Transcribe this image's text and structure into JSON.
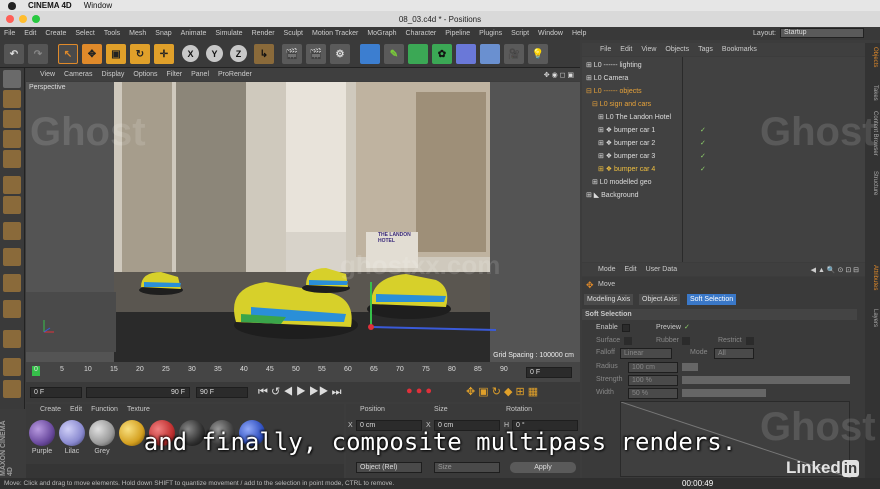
{
  "mac_menu": {
    "app": "CINEMA 4D",
    "window": "Window"
  },
  "window_title": "08_03.c4d * - Positions",
  "menubar": [
    "File",
    "Edit",
    "Create",
    "Select",
    "Tools",
    "Mesh",
    "Snap",
    "Animate",
    "Simulate",
    "Render",
    "Sculpt",
    "Motion Tracker",
    "MoGraph",
    "Character",
    "Pipeline",
    "Plugins",
    "Script",
    "Window",
    "Help"
  ],
  "layout": {
    "label": "Layout:",
    "value": "Startup"
  },
  "viewport_menu": [
    "View",
    "Cameras",
    "Display",
    "Options",
    "Filter",
    "Panel",
    "ProRender"
  ],
  "viewport": {
    "name": "Perspective",
    "grid_spacing": "Grid Spacing : 100000 cm",
    "sign_text": "THE LANDON HOTEL"
  },
  "timeline": {
    "ticks": [
      "0",
      "5",
      "10",
      "15",
      "20",
      "25",
      "30",
      "35",
      "40",
      "45",
      "50",
      "55",
      "60",
      "65",
      "70",
      "75",
      "80",
      "85",
      "90"
    ],
    "current": "0 F"
  },
  "transport": {
    "start": "0 F",
    "end_a": "90 F",
    "end_b": "90 F"
  },
  "materials": {
    "menu": [
      "Create",
      "Edit",
      "Function",
      "Texture"
    ],
    "items": [
      {
        "name": "Purple",
        "color": "#6a4a9e"
      },
      {
        "name": "Lilac",
        "color": "#8a8ad0"
      },
      {
        "name": "Grey",
        "color": "#9a9a9a"
      },
      {
        "name": "",
        "color": "#d4a020"
      },
      {
        "name": "",
        "color": "#c03030"
      },
      {
        "name": "",
        "color": "#303030"
      },
      {
        "name": "",
        "color": "#404040"
      },
      {
        "name": "",
        "color": "#3050c0"
      }
    ]
  },
  "coordinates": {
    "headers": [
      "Position",
      "Size",
      "Rotation"
    ],
    "x_pos": "0 cm",
    "x_size": "0 cm",
    "h_rot": "0 °",
    "axis_x": "X",
    "axis_size": "X",
    "axis_h": "H",
    "mode": "Object (Rel)",
    "size_mode": "Size",
    "apply": "Apply"
  },
  "object_manager": {
    "menu": [
      "File",
      "Edit",
      "View",
      "Objects",
      "Tags",
      "Bookmarks"
    ],
    "rows": [
      {
        "label": "------ lighting",
        "color": "#dddddd",
        "indent": 0,
        "checked": false
      },
      {
        "label": "Camera",
        "color": "#dddddd",
        "indent": 0,
        "checked": false
      },
      {
        "label": "------ objects",
        "color": "#e8a33a",
        "indent": 0,
        "checked": false
      },
      {
        "label": "sign and cars",
        "color": "#e8a33a",
        "indent": 1,
        "checked": false
      },
      {
        "label": "The Landon Hotel",
        "color": "#dddddd",
        "indent": 2,
        "checked": false
      },
      {
        "label": "bumper car 1",
        "color": "#dddddd",
        "indent": 2,
        "checked": true
      },
      {
        "label": "bumper car 2",
        "color": "#dddddd",
        "indent": 2,
        "checked": true
      },
      {
        "label": "bumper car 3",
        "color": "#dddddd",
        "indent": 2,
        "checked": true
      },
      {
        "label": "bumper car 4",
        "color": "#f0c040",
        "indent": 2,
        "checked": true
      },
      {
        "label": "modelled geo",
        "color": "#dddddd",
        "indent": 1,
        "checked": false
      },
      {
        "label": "Background",
        "color": "#dddddd",
        "indent": 0,
        "checked": false
      }
    ]
  },
  "attributes": {
    "menu": [
      "Mode",
      "Edit",
      "User Data"
    ],
    "title": "Move",
    "tabs": [
      "Modeling Axis",
      "Object Axis",
      "Soft Selection"
    ],
    "section": "Soft Selection",
    "enable": "Enable",
    "preview": "Preview",
    "surface": "Surface",
    "rubber": "Rubber",
    "restrict": "Restrict",
    "falloff": "Falloff",
    "falloff_value": "Linear",
    "mode": "Mode",
    "mode_value": "All",
    "radius": "Radius",
    "radius_value": "100 cm",
    "strength": "Strength",
    "strength_value": "100 %",
    "width": "Width",
    "width_value": "50 %"
  },
  "right_tabs": [
    "Objects",
    "Takes",
    "Content Browser",
    "Structure",
    "Attributes",
    "Layers"
  ],
  "subtitle": "and finally, composite multipass renders.",
  "watermark": "Ghost",
  "watermark_center": "ghostxx.com",
  "linkedin": {
    "text": "Linked",
    "badge": "in",
    "time": "00:00:49"
  },
  "status": "Move: Click and drag to move elements. Hold down SHIFT to quantize movement / add to the selection in point mode, CTRL to remove."
}
